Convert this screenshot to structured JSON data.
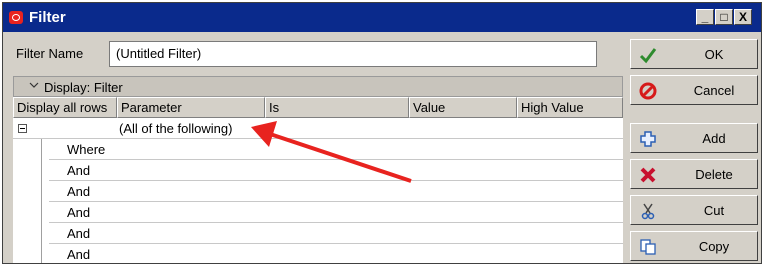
{
  "window": {
    "title": "Filter"
  },
  "title_buttons": {
    "minimize": "_",
    "maximize": "□",
    "close": "X"
  },
  "filter_name": {
    "label": "Filter Name",
    "value": "(Untitled Filter)"
  },
  "display_section": {
    "label": "Display: Filter"
  },
  "columns": [
    "Display all rows",
    "Parameter",
    "Is",
    "Value",
    "High Value"
  ],
  "group": {
    "label": "(All of the following)"
  },
  "conditions": [
    "Where",
    "And",
    "And",
    "And",
    "And",
    "And"
  ],
  "buttons": [
    {
      "label": "OK",
      "icon": "check-icon"
    },
    {
      "label": "Cancel",
      "icon": "cancel-icon"
    },
    {
      "label": "Add",
      "icon": "add-icon"
    },
    {
      "label": "Delete",
      "icon": "delete-icon"
    },
    {
      "label": "Cut",
      "icon": "cut-icon"
    },
    {
      "label": "Copy",
      "icon": "copy-icon"
    }
  ],
  "annotation_color": "#e8231f"
}
